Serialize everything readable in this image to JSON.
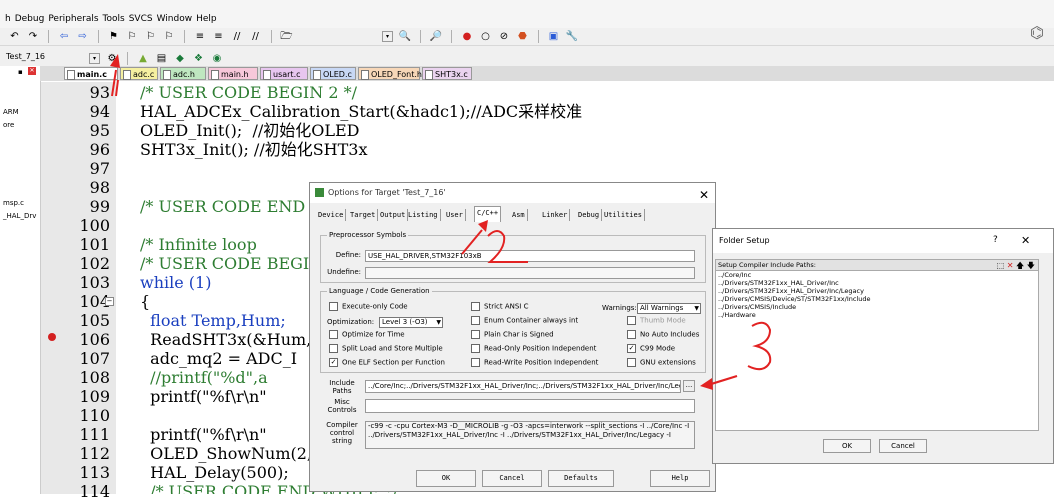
{
  "menu": [
    "h",
    "Debug",
    "Peripherals",
    "Tools",
    "SVCS",
    "Window",
    "Help"
  ],
  "target": {
    "name": "Test_7_16"
  },
  "tabs": [
    {
      "label": "main.c",
      "color": "#e3e3e3"
    },
    {
      "label": "adc.c",
      "color": "#f5f0a0"
    },
    {
      "label": "adc.h",
      "color": "#bfe7c0"
    },
    {
      "label": "main.h",
      "color": "#f7c8da"
    },
    {
      "label": "usart.c",
      "color": "#e7c6ef"
    },
    {
      "label": "OLED.c",
      "color": "#c8d8f5"
    },
    {
      "label": "OLED_Font.h",
      "color": "#f7d7b8"
    },
    {
      "label": "SHT3x.c",
      "color": "#ead3ef"
    }
  ],
  "left_panel": [
    "ARM",
    "ore",
    "msp.c",
    "_HAL_Drv"
  ],
  "code": {
    "line_numbers": [
      "93",
      "94",
      "95",
      "96",
      "97",
      "98",
      "99",
      "100",
      "101",
      "102",
      "103",
      "104",
      "105",
      "106",
      "107",
      "108",
      "109",
      "110",
      "111",
      "112",
      "113",
      "114"
    ],
    "lines": [
      "/* USER CODE BEGIN 2 */",
      "HAL_ADCEx_Calibration_Start(&hadc1);//ADC采样校准",
      "OLED_Init();  //初始化OLED",
      "SHT3x_Init(); //初始化SHT3x",
      "",
      "",
      "/* USER CODE END",
      "",
      "/* Infinite loop",
      "/* USER CODE BEGI",
      "while (1)",
      "{",
      "  float Temp,Hum;",
      "  ReadSHT3x(&Hum,",
      "  adc_mq2 = ADC_I",
      "  //printf(\"%d\",a",
      "  printf(\"%f\\r\\n\"",
      "",
      "  printf(\"%f\\r\\n\"",
      "  OLED_ShowNum(2,",
      "  HAL_Delay(500);",
      "  /* USER CODE END WHILE */"
    ]
  },
  "dialog": {
    "title": "Options for Target 'Test_7_16'",
    "close": "✕",
    "tabs": [
      "Device",
      "Target",
      "Output",
      "Listing",
      "User",
      "C/C++",
      "Asm",
      "Linker",
      "Debug",
      "Utilities"
    ],
    "active_tab": "C/C++",
    "preprocessor": {
      "group": "Preprocessor Symbols",
      "define_label": "Define:",
      "define_value": "USE_HAL_DRIVER,STM32F103xB",
      "undefine_label": "Undefine:"
    },
    "lang": {
      "group": "Language / Code Generation",
      "col1": [
        {
          "label": "Execute-only Code",
          "checked": false,
          "disabled": false
        },
        {
          "label": "Optimize for Time",
          "checked": false,
          "disabled": false
        },
        {
          "label": "Split Load and Store Multiple",
          "checked": false,
          "disabled": false
        },
        {
          "label": "One ELF Section per Function",
          "checked": true,
          "disabled": false
        }
      ],
      "optimization_label": "Optimization:",
      "optimization_value": "Level 3 (-O3)",
      "col2": [
        {
          "label": "Strict ANSI C",
          "checked": false,
          "disabled": false
        },
        {
          "label": "Enum Container always int",
          "checked": false,
          "disabled": false
        },
        {
          "label": "Plain Char is Signed",
          "checked": false,
          "disabled": false
        },
        {
          "label": "Read-Only Position Independent",
          "checked": false,
          "disabled": false
        },
        {
          "label": "Read-Write Position Independent",
          "checked": false,
          "disabled": false
        }
      ],
      "warnings_label": "Warnings:",
      "warnings_value": "All Warnings",
      "col3": [
        {
          "label": "Thumb Mode",
          "checked": false,
          "disabled": true
        },
        {
          "label": "No Auto Includes",
          "checked": false,
          "disabled": false
        },
        {
          "label": "C99 Mode",
          "checked": true,
          "disabled": false
        },
        {
          "label": "GNU extensions",
          "checked": false,
          "disabled": false
        }
      ]
    },
    "include_label": "Include\nPaths",
    "include_value": "../Core/Inc;../Drivers/STM32F1xx_HAL_Driver/Inc;../Drivers/STM32F1xx_HAL_Driver/Inc/Legacy;",
    "browse": "...",
    "misc_label": "Misc\nControls",
    "compiler_label": "Compiler\ncontrol\nstring",
    "compiler_value_1": "-c99 -c -cpu Cortex-M3 -D__MICROLIB -g -O3 -apcs=interwork --split_sections -I ../Core/Inc -I",
    "compiler_value_2": "../Drivers/STM32F1xx_HAL_Driver/Inc -I ../Drivers/STM32F1xx_HAL_Driver/Inc/Legacy -I",
    "buttons": {
      "ok": "OK",
      "cancel": "Cancel",
      "defaults": "Defaults",
      "help": "Help"
    }
  },
  "folder_setup": {
    "title": "Folder Setup",
    "help": "?",
    "close": "✕",
    "header": "Setup Compiler Include Paths:",
    "items": [
      "../Core/Inc",
      "../Drivers/STM32F1xx_HAL_Driver/Inc",
      "../Drivers/STM32F1xx_HAL_Driver/Inc/Legacy",
      "../Drivers/CMSIS/Device/ST/STM32F1xx/Include",
      "../Drivers/CMSIS/Include",
      "../Hardware"
    ],
    "ok": "OK",
    "cancel": "Cancel"
  },
  "annotations": {
    "two": "2",
    "three": "3"
  },
  "colors": {
    "annotation": "#e22222",
    "comment": "#2e7d32",
    "keyword": "#1a3fbf"
  }
}
